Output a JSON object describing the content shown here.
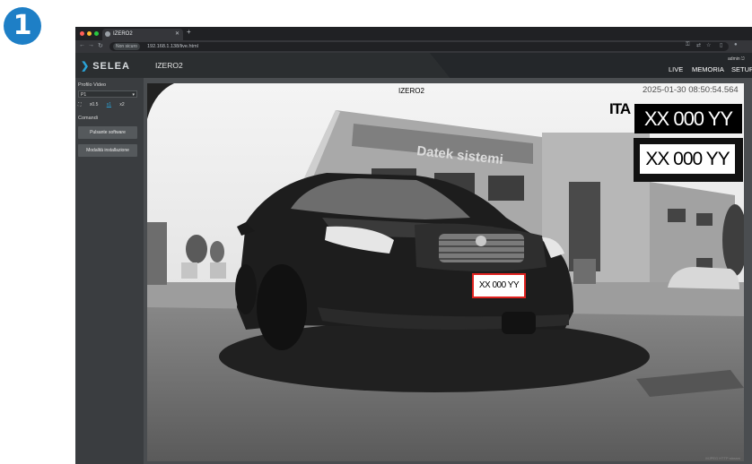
{
  "step_number": "1",
  "browser": {
    "tab_title": "IZERO2",
    "security_label": "Non sicuro",
    "url": "192.168.1.138/live.html"
  },
  "header": {
    "logo_text": "SELEA",
    "device_name": "IZERO2",
    "user": "admin",
    "nav": [
      "LIVE",
      "MEMORIA",
      "SETUP"
    ]
  },
  "sidebar": {
    "video_profile_label": "Profilo Video",
    "video_profile_value": "P1",
    "zoom_options": [
      "x0.5",
      "x1",
      "x2"
    ],
    "zoom_selected": "x1",
    "commands_label": "Comandi",
    "software_trigger_button": "Pulsante software",
    "install_mode_button": "Modalità installazione"
  },
  "video": {
    "camera_name": "IZERO2",
    "timestamp": "2025-01-30  08:50:54.564",
    "country_code": "ITA",
    "plate_text": "XX 000 YY",
    "plate_crop_text": "XX 000 YY",
    "detected_plate_text": "XX 000 YY",
    "building_sign": "Datek sistemi",
    "stream_status": "MJPEG HTTP stream"
  },
  "colors": {
    "accent": "#2aa3d8",
    "step_badge": "#1e7fc6",
    "detection_box": "#e0221f",
    "app_background": "#3a3d40"
  }
}
